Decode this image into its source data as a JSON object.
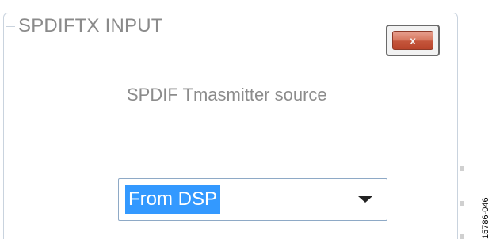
{
  "panel": {
    "title": "SPDIFTX INPUT"
  },
  "close_button": {
    "label": "x",
    "icon": "close-icon"
  },
  "field": {
    "label": "SPDIF Tmasmitter source"
  },
  "dropdown": {
    "selected_value": "From DSP",
    "icon": "chevron-down-icon"
  },
  "figure": {
    "number": "15786-046"
  },
  "colors": {
    "selection": "#3399ff",
    "close_button": "#c4553b",
    "border": "#c9d3de",
    "text": "#8c8c8c"
  }
}
